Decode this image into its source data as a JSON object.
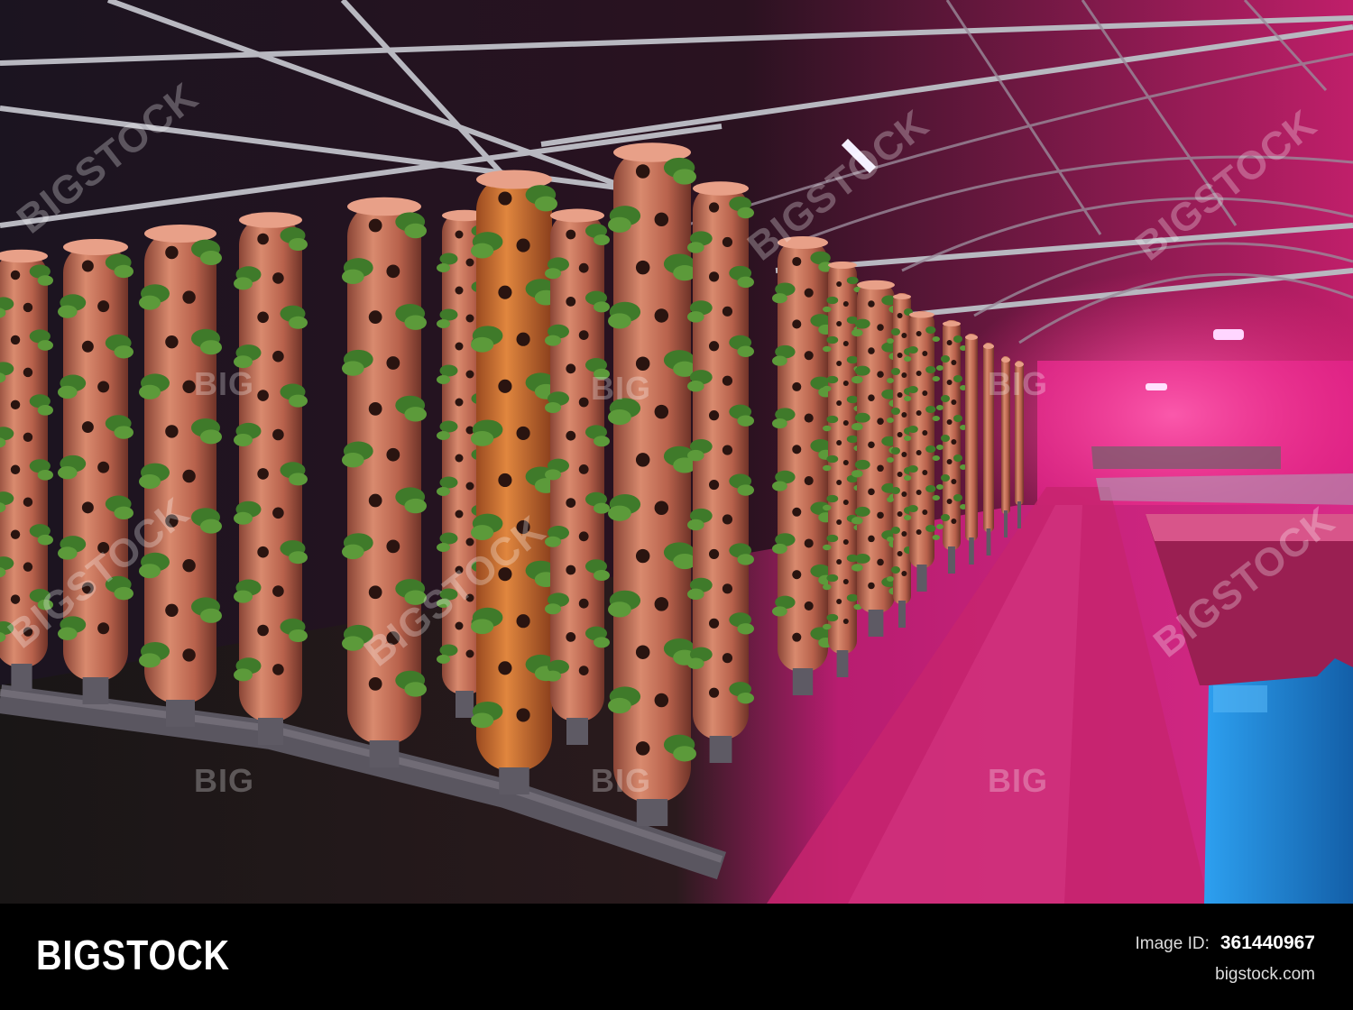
{
  "watermarks": {
    "diag_text": "BIGSTOCK",
    "small_text": "BIG"
  },
  "footer": {
    "brand": "BIGSTOCK",
    "image_id_label": "Image ID:",
    "image_id": "361440967",
    "site": "bigstock.com"
  },
  "colors": {
    "tube": "#b8624c",
    "tube_highlight": "#d98a5e",
    "leaf": "#3f7a2a",
    "pink_light": "#ff2e8c",
    "container_blue": "#1f86d8"
  }
}
